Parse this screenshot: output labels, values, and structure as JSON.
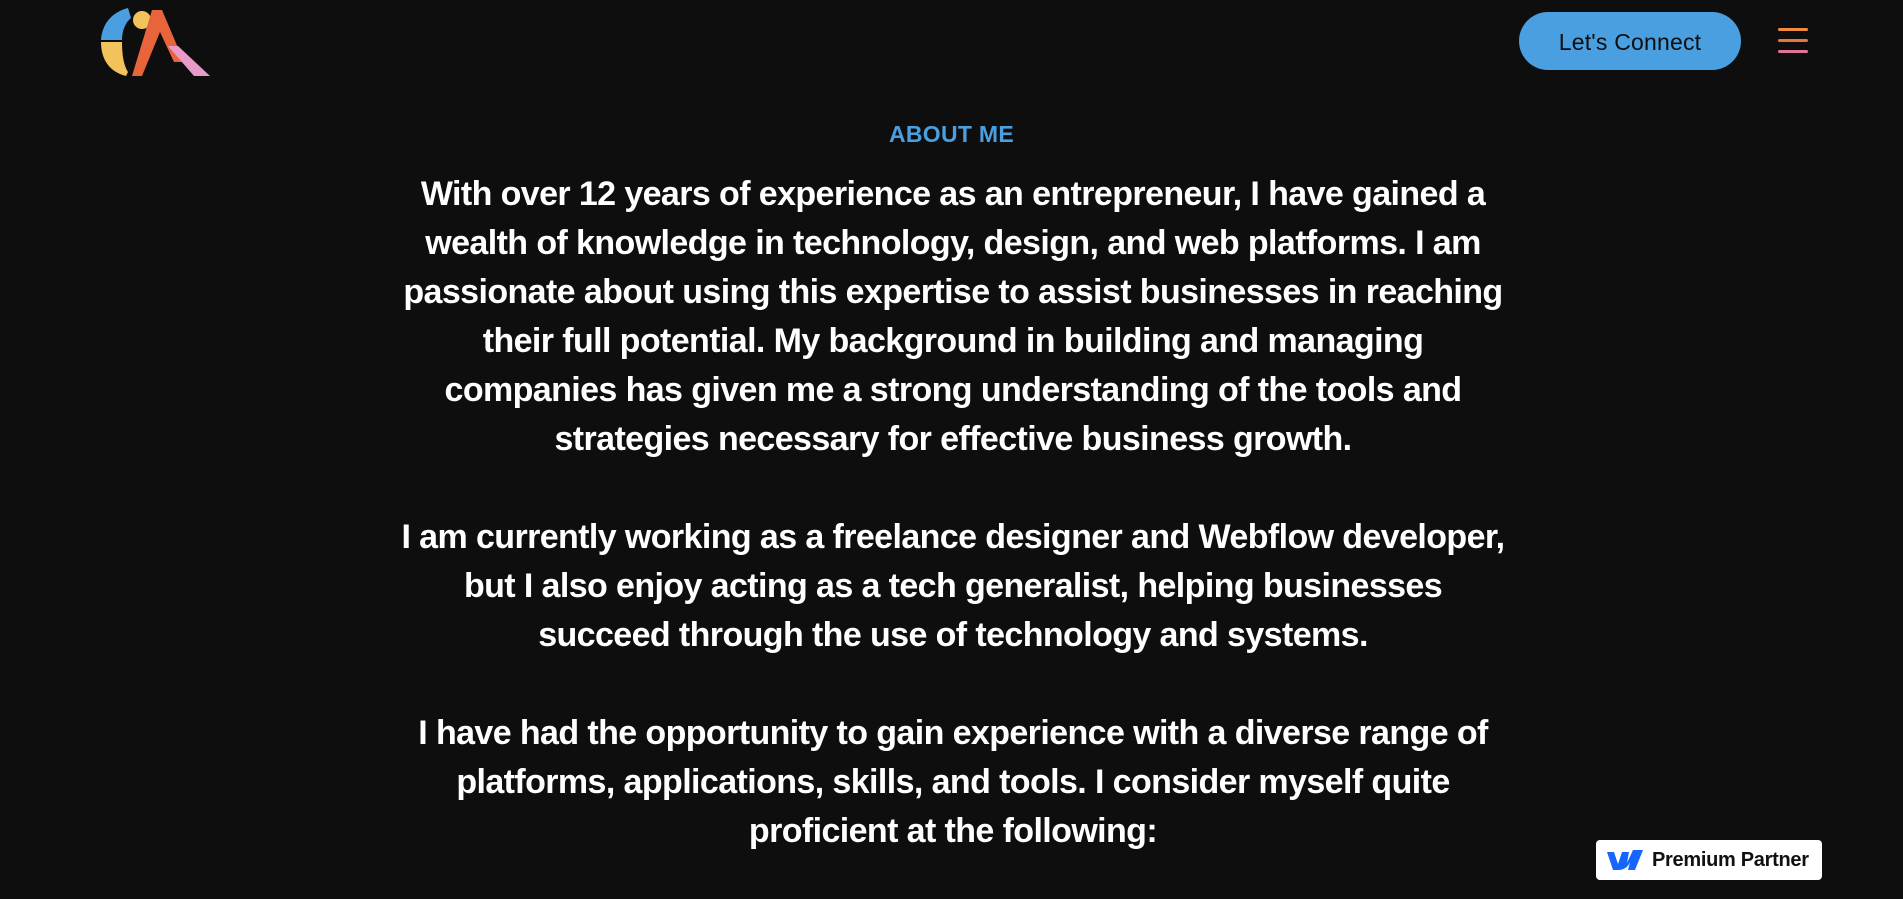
{
  "header": {
    "logo_name": "CA monogram logo",
    "cta_label": "Let's Connect",
    "menu_icon": "hamburger-menu-icon"
  },
  "about": {
    "eyebrow": "ABOUT ME",
    "paragraphs": [
      "With over 12 years of experience as an entrepreneur, I have gained a wealth of knowledge in technology, design, and web platforms. I am passionate about using this expertise to assist businesses in reaching their full potential. My background in building and managing companies has given me a strong understanding of the tools and strategies necessary for effective business growth.",
      "I am currently working as a freelance designer and Webflow developer, but I also enjoy acting as a tech generalist, helping businesses succeed through the use of technology and systems.",
      "I have had the opportunity to gain experience with a diverse range of platforms, applications, skills, and tools. I consider myself quite proficient at the following:"
    ]
  },
  "badge": {
    "label": "Premium Partner",
    "icon": "webflow-icon"
  },
  "colors": {
    "background": "#0e0e0f",
    "accent_blue": "#4a9fe0",
    "text": "#ffffff",
    "logo_blue": "#4a9fe0",
    "logo_yellow": "#f2c35a",
    "logo_orange": "#e8643a",
    "logo_pink": "#e89ac8",
    "menu_orange": "#f08a3c",
    "menu_pink": "#e0729c"
  }
}
